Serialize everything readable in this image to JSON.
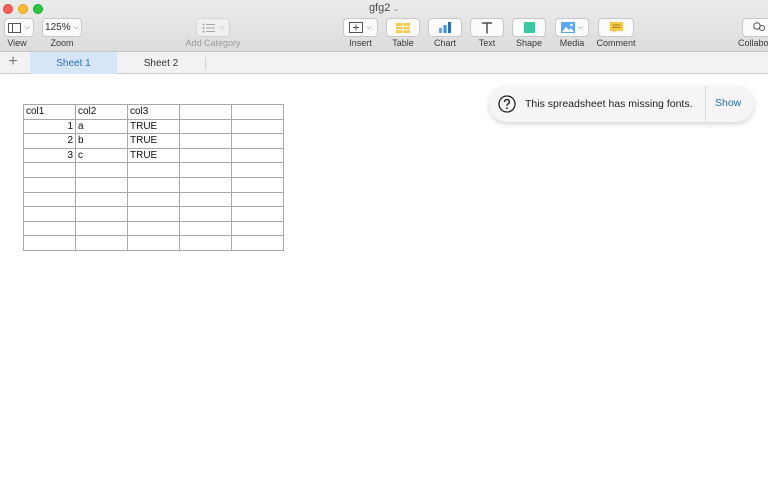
{
  "window": {
    "title": "gfg2"
  },
  "toolbar": {
    "view_label": "View",
    "zoom_value": "125%",
    "zoom_label": "Zoom",
    "add_category_label": "Add Category",
    "insert_label": "Insert",
    "table_label": "Table",
    "chart_label": "Chart",
    "text_label": "Text",
    "shape_label": "Shape",
    "media_label": "Media",
    "comment_label": "Comment",
    "collaborate_label": "Collabo"
  },
  "tabs": [
    {
      "label": "Sheet 1",
      "active": true
    },
    {
      "label": "Sheet 2",
      "active": false
    }
  ],
  "table": {
    "rows": [
      [
        "col1",
        "col2",
        "col3",
        "",
        ""
      ],
      [
        "1",
        "a",
        "TRUE",
        "",
        ""
      ],
      [
        "2",
        "b",
        "TRUE",
        "",
        ""
      ],
      [
        "3",
        "c",
        "TRUE",
        "",
        ""
      ],
      [
        "",
        "",
        "",
        "",
        ""
      ],
      [
        "",
        "",
        "",
        "",
        ""
      ],
      [
        "",
        "",
        "",
        "",
        ""
      ],
      [
        "",
        "",
        "",
        "",
        ""
      ],
      [
        "",
        "",
        "",
        "",
        ""
      ],
      [
        "",
        "",
        "",
        "",
        ""
      ]
    ]
  },
  "notification": {
    "message": "This spreadsheet has missing fonts.",
    "action_label": "Show"
  },
  "colors": {
    "accent": "#2a6fb8",
    "active_tab_bg": "#d6e6f7"
  }
}
